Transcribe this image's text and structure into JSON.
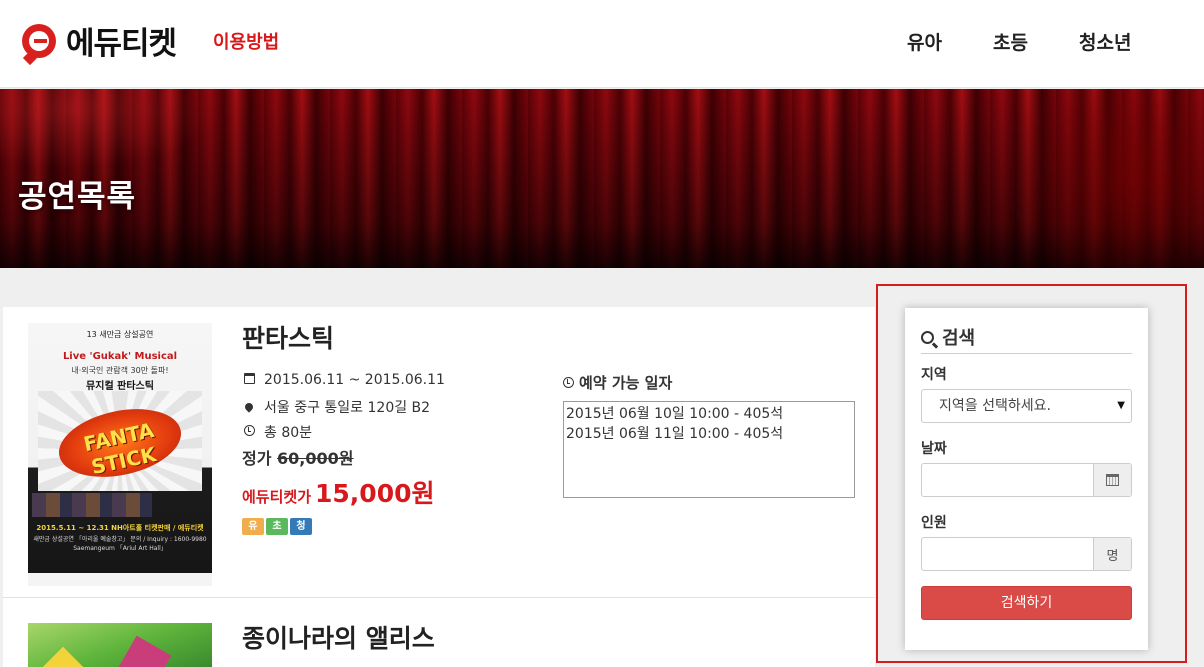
{
  "header": {
    "brand": "에듀티켓",
    "howto": "이용방법",
    "nav": [
      "유아",
      "초등",
      "청소년"
    ]
  },
  "banner": {
    "title": "공연목록"
  },
  "shows": [
    {
      "title": "판타스틱",
      "date_range": "2015.06.11 ~ 2015.06.11",
      "place": "서울 중구 통일로 120길 B2",
      "duration": "총 80분",
      "regular_label": "정가",
      "regular_price": "60,000원",
      "edu_label": "에듀티켓가",
      "edu_price": "15,000원",
      "badges": [
        {
          "text": "유",
          "color": "#f0ad4e"
        },
        {
          "text": "초",
          "color": "#5cb85c"
        },
        {
          "text": "청",
          "color": "#337ab7"
        }
      ],
      "availability_title": "예약 가능 일자",
      "availability": [
        "2015년 06월 10일 10:00 - 405석",
        "2015년 06월 11일 10:00 - 405석"
      ],
      "poster": {
        "top": "13 새만금 상설공연",
        "sub": "Live 'Gukak' Musical",
        "sub2": "내·외국인 관람객 30만 돌파!",
        "name": "뮤지컬 판타스틱",
        "logo": "FANTA STICK",
        "date": "2015.5.11 ~ 12.31  NH아트홀 티켓판매 / 에듀티켓",
        "info1": "새만금 상설공연 「아리울 예술창고」 문의 / Inquiry : 1600-9980",
        "info2": "Saemangeum 「Ariul Art Hall」"
      }
    },
    {
      "title": "종이나라의 앨리스"
    }
  ],
  "search": {
    "title": "검색",
    "region_label": "지역",
    "region_placeholder": "지역을 선택하세요.",
    "date_label": "날짜",
    "people_label": "인원",
    "people_unit": "명",
    "button": "검색하기"
  },
  "colors": {
    "brand_red": "#d9181b",
    "button_red": "#da4b47",
    "highlight_border": "#d81b1b"
  },
  "icons": {
    "logo": "edu-logo-icon",
    "calendar": "calendar-icon",
    "pin": "map-pin-icon",
    "clock": "clock-icon",
    "search": "search-icon",
    "dropdown": "chevron-down-icon"
  }
}
